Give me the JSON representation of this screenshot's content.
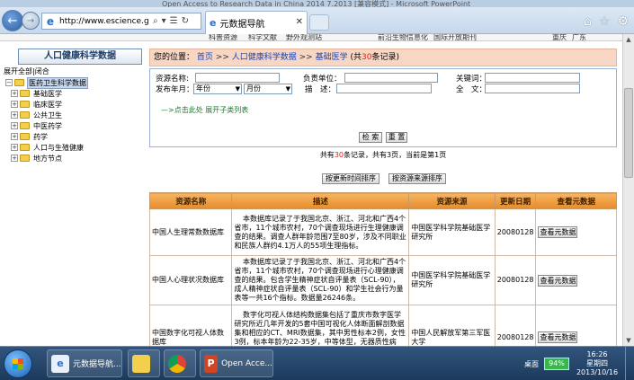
{
  "ppt_title": "Open Access to Research Data in China 2014 7.2013 [兼容模式] - Microsoft PowerPoint",
  "browser": {
    "address_url": "http://www.escience.g",
    "tab_title": "元数据导航",
    "icons": [
      "back-icon",
      "forward-icon",
      "search-icon",
      "refresh-icon",
      "home-icon",
      "star-icon",
      "gear-icon"
    ]
  },
  "topnav": [
    "科普资源",
    "科学文献",
    "野外观测站",
    "前沿生物信息化",
    "国际开放期刊",
    "重庆",
    "广东"
  ],
  "sidebar": {
    "title": "人口健康科学数据",
    "expand_all": "展开全部",
    "separator": "|",
    "collapse": "闭合",
    "root": "医药卫生科学数据",
    "items": [
      "基础医学",
      "临床医学",
      "公共卫生",
      "中医药学",
      "药学",
      "人口与生殖健康",
      "地方节点"
    ]
  },
  "breadcrumb": {
    "prefix": "您的位置：",
    "home": "首页",
    "sep": ">>",
    "level1": "人口健康科学数据",
    "level2": "基础医学",
    "count_open": "(共",
    "count": "30",
    "count_close": "条记录)"
  },
  "search": {
    "resource_name_label": "资源名称:",
    "responsible_label": "负责单位：",
    "keyword_label": "关键词：",
    "publish_date_label": "发布年月：",
    "year_option": "年份",
    "month_option": "月份",
    "describe_label": "描　述：",
    "fulltext_label": "全　文：",
    "show_categories": "—>点击此处 展开子类列表",
    "search_button": "检 索",
    "reset_button": "重 置"
  },
  "summary": {
    "text1": "共有",
    "total": "30",
    "text2": "条记录，共有",
    "pages": "3",
    "text3": "页，当前是第",
    "current": "1",
    "text4": "页"
  },
  "sort": {
    "by_time": "按更新时间排序",
    "by_source": "按资源来源排序"
  },
  "table": {
    "headers": [
      "资源名称",
      "描述",
      "资源来源",
      "更新日期",
      "查看元数据"
    ],
    "rows": [
      {
        "name": "中国人生理常数数据库",
        "desc": "本数据库记录了于我国北京、浙江、河北和广西4个省市，11个城市农村，70个调查现场进行生理健康调查的结果。调查人群年龄范围7至80岁，涉及不同职业和民族人群约4.1万人的55项生理指标。",
        "source": "中国医学科学院基础医学研究所",
        "date": "20080128",
        "view": "查看元数据"
      },
      {
        "name": "中国人心理状况数据库",
        "desc": "本数据库记录了于我国北京、浙江、河北和广西4个省市，11个城市农村，70个调查现场进行心理健康调查的结果。包含学生精神症状自评量表（SCL-90），成人精神症状自评量表（SCL-90）和学生社会行为量表等一共16个指标。数据量26246条。",
        "source": "中国医学科学院基础医学研究所",
        "date": "20080128",
        "view": "查看元数据"
      },
      {
        "name": "中国数字化可视人体数据库",
        "desc": "数字化可视人体结构数据集包括了重庆市数字医学研究所近几年开发的5套中国可视化人体断面解剖数据集和相应的CT、MRI数据集，其中男性标本2例，女性3例，标本年龄为22-35岁，中等体型，无器质性病伤，代表性较好。而且，该数据集为超薄低温冷冻铣切断面解剖图像，层厚0.1-0.5，几乎包含人体所有大",
        "source": "中国人民解放军第三军医大学",
        "date": "20080128",
        "view": "查看元数据"
      }
    ]
  },
  "taskbar": {
    "items": [
      "元数据导航...",
      "",
      "",
      "Open Acce..."
    ],
    "desktop": "桌面",
    "battery": "94%",
    "time": "16:26",
    "day": "星期四",
    "date": "2013/10/16"
  }
}
